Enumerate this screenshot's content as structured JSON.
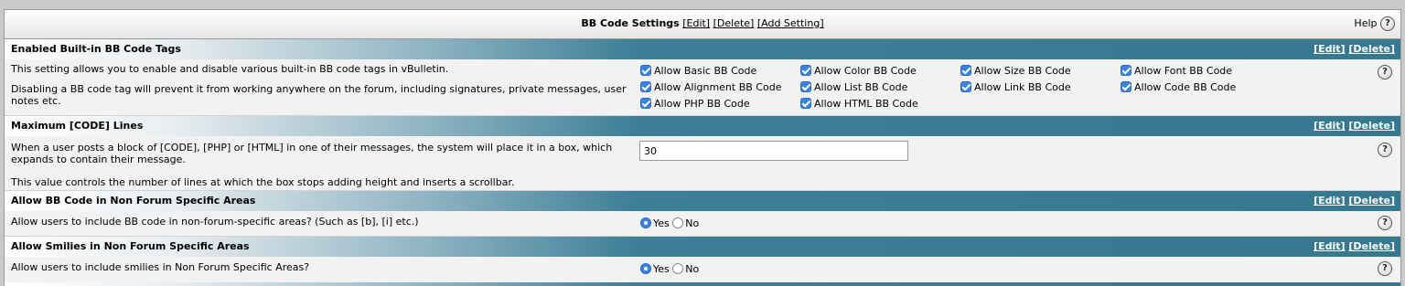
{
  "title": {
    "text": "BB Code Settings",
    "edit": "[Edit]",
    "delete": "[Delete]",
    "add": "[Add Setting]",
    "help": "Help",
    "help_icon": "?"
  },
  "sections": [
    {
      "header": "Enabled Built-in BB Code Tags",
      "edit": "[Edit]",
      "delete": "[Delete]",
      "desc1": "This setting allows you to enable and disable various built-in BB code tags in vBulletin.",
      "desc2": "Disabling a BB code tag will prevent it from working anywhere on the forum, including signatures, private messages, user notes etc.",
      "checkboxes": [
        "Allow Basic BB Code",
        "Allow Color BB Code",
        "Allow Size BB Code",
        "Allow Font BB Code",
        "Allow Alignment BB Code",
        "Allow List BB Code",
        "Allow Link BB Code",
        "Allow Code BB Code",
        "Allow PHP BB Code",
        "Allow HTML BB Code"
      ],
      "checked": [
        true,
        true,
        true,
        true,
        true,
        true,
        true,
        true,
        true,
        true
      ]
    },
    {
      "header": "Maximum [CODE] Lines",
      "edit": "[Edit]",
      "delete": "[Delete]",
      "desc1": "When a user posts a block of [CODE], [PHP] or [HTML] in one of their messages, the system will place it in a box, which expands to contain their message.",
      "desc2": "This value controls the number of lines at which the box stops adding height and inserts a scrollbar.",
      "value": "30"
    },
    {
      "header": "Allow BB Code in Non Forum Specific Areas",
      "edit": "[Edit]",
      "delete": "[Delete]",
      "desc1": "Allow users to include BB code in non-forum-specific areas? (Such as [b], [i] etc.)",
      "yes": "Yes",
      "no": "No",
      "selected": "Yes"
    },
    {
      "header": "Allow Smilies in Non Forum Specific Areas",
      "edit": "[Edit]",
      "delete": "[Delete]",
      "desc1": "Allow users to include smilies in Non Forum Specific Areas?",
      "yes": "Yes",
      "no": "No",
      "selected": "Yes"
    }
  ],
  "colors": {
    "header_bar": "#35788f",
    "checkbox": "#3b83e0"
  }
}
